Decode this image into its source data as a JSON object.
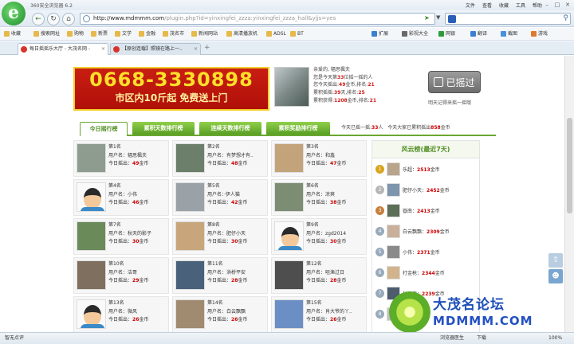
{
  "browser": {
    "app_title": "360安全浏览器 6.2",
    "menu": [
      "文件",
      "查看",
      "收藏",
      "工具",
      "帮助"
    ],
    "url_host": "http://www.mdmmm.com",
    "url_path": "/plugin.php?id=yinxingfei_zzza:yinxingfei_zzza_hall&yjjs=yes",
    "bookmarks_left": [
      "收藏",
      "搜索网址",
      "购物",
      "新票",
      "文学",
      "金融",
      "茂名市",
      "新闻网站",
      "高清播放机",
      "ADSL",
      "BT"
    ],
    "bookmarks_right": [
      "扩展",
      "影视大全",
      "网银",
      "翻译",
      "截图",
      "游戏"
    ],
    "tabs": [
      {
        "label": "每日摇摇乐大厅 - 大茂名网 - ",
        "active": true
      },
      {
        "label": "【原创连载】照镜在路上一..",
        "active": false
      }
    ],
    "status_left": "智无点评",
    "status_right": [
      "浏览器医生",
      "下载",
      "100%"
    ]
  },
  "banner": {
    "phone": "0668-3330898",
    "tagline": "市区内10斤起  免费送上门"
  },
  "shake": {
    "greeting_prefix": "亲爱的, ",
    "username": "辐思楓夫",
    "line2_a": "您是今天第",
    "line2_num": "33",
    "line2_b": "位摇一摇的人",
    "line3_a": "您今天摇出:",
    "line3_num": "49",
    "line3_b": "金币,排名:",
    "line3_rank": "21",
    "line4_a": "累积摇摇:",
    "line4_num": "39",
    "line4_b": "天,排名:",
    "line4_rank": "25",
    "line5_a": "累积获得:",
    "line5_num": "1208",
    "line5_b": "金币,排名:",
    "line5_rank": "21",
    "button_label": "已摇过",
    "note": "明天记得来摇一摇哦"
  },
  "rank_tabs": [
    "今日摇行榜",
    "累积天数排行榜",
    "连续天数排行榜",
    "累积奖励排行榜"
  ],
  "today_stats": {
    "a": "今天已摇一摇:",
    "count": "33",
    "b": "人",
    "c": "今天大家已累积摇出",
    "total": "858",
    "d": "金币"
  },
  "users": [
    {
      "rank": "第1名",
      "name": "辐思楓夫",
      "coins": "49"
    },
    {
      "rank": "第2名",
      "name": "有梦想才有..",
      "coins": "48"
    },
    {
      "rank": "第3名",
      "name": "和鑫",
      "coins": "47"
    },
    {
      "rank": "第4名",
      "name": "小伟",
      "coins": "46"
    },
    {
      "rank": "第5名",
      "name": "·伊人猫",
      "coins": "42"
    },
    {
      "rank": "第6名",
      "name": "凉爽",
      "coins": "38"
    },
    {
      "rank": "第7名",
      "name": "秋天的影子",
      "coins": "30"
    },
    {
      "rank": "第8名",
      "name": "肥仔小天",
      "coins": "30"
    },
    {
      "rank": "第9名",
      "name": "zgd2014",
      "coins": "30"
    },
    {
      "rank": "第10名",
      "name": "洁哥",
      "coins": "29"
    },
    {
      "rank": "第11名",
      "name": "洪桥平安",
      "coins": "28"
    },
    {
      "rank": "第12名",
      "name": "咀渔过日",
      "coins": "28"
    },
    {
      "rank": "第13名",
      "name": "微风",
      "coins": "26"
    },
    {
      "rank": "第14名",
      "name": "白云飘飘",
      "coins": "26"
    },
    {
      "rank": "第15名",
      "name": "肖大爷的丫..",
      "coins": "26"
    }
  ],
  "user_labels": {
    "name_prefix": "用户名：",
    "today_prefix": "今日摇出：",
    "coin_unit": "金币"
  },
  "fame": {
    "title": "风云榜(最近7天)",
    "rows": [
      {
        "name": "乐超",
        "coins": "2513"
      },
      {
        "name": "肥仔小天",
        "coins": "2452"
      },
      {
        "name": "嶽南",
        "coins": "2413"
      },
      {
        "name": "白云飘飘",
        "coins": "2309"
      },
      {
        "name": "小伟",
        "coins": "2371"
      },
      {
        "name": "打金枪",
        "coins": "2344"
      },
      {
        "name": "秋无痕",
        "coins": "2239"
      },
      {
        "name": "",
        "coins": ""
      }
    ],
    "coin_unit": "金币"
  },
  "watermark": {
    "cn": "大茂名论坛",
    "en": "MDMMM.COM"
  },
  "colors": {
    "accent_green": "#6aa830",
    "banner_red": "#c91e12",
    "banner_yellow": "#ffdf2a",
    "coin_red": "#cc0000"
  }
}
